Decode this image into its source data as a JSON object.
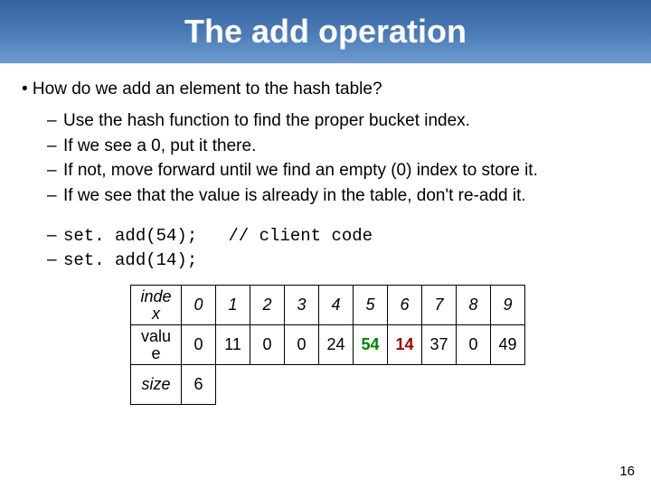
{
  "title": "The add operation",
  "question": "• How do we add an element to the hash table?",
  "steps": [
    "Use the hash function to find the proper bucket index.",
    "If we see a 0, put it there.",
    "If not, move forward until we find an empty (0) index to store it.",
    "If we see that the value is already in the table, don't re-add it."
  ],
  "code": {
    "line1": "set. add(54);",
    "line2": "set. add(14);",
    "comment": "// client code"
  },
  "table": {
    "row_labels": {
      "index": "inde x",
      "value": "valu e",
      "size": "size"
    },
    "indices": [
      "0",
      "1",
      "2",
      "3",
      "4",
      "5",
      "6",
      "7",
      "8",
      "9"
    ],
    "values": [
      "0",
      "11",
      "0",
      "0",
      "24",
      "54",
      "14",
      "37",
      "0",
      "49"
    ],
    "size": "6",
    "highlight": {
      "col5": "54",
      "col6": "14"
    }
  },
  "page_number": "16",
  "chart_data": {
    "type": "table",
    "title": "Hash table state after add(54) and add(14)",
    "columns": [
      "index",
      "value"
    ],
    "rows": [
      {
        "index": 0,
        "value": 0
      },
      {
        "index": 1,
        "value": 11
      },
      {
        "index": 2,
        "value": 0
      },
      {
        "index": 3,
        "value": 0
      },
      {
        "index": 4,
        "value": 24
      },
      {
        "index": 5,
        "value": 54
      },
      {
        "index": 6,
        "value": 14
      },
      {
        "index": 7,
        "value": 37
      },
      {
        "index": 8,
        "value": 0
      },
      {
        "index": 9,
        "value": 49
      }
    ],
    "size": 6
  }
}
